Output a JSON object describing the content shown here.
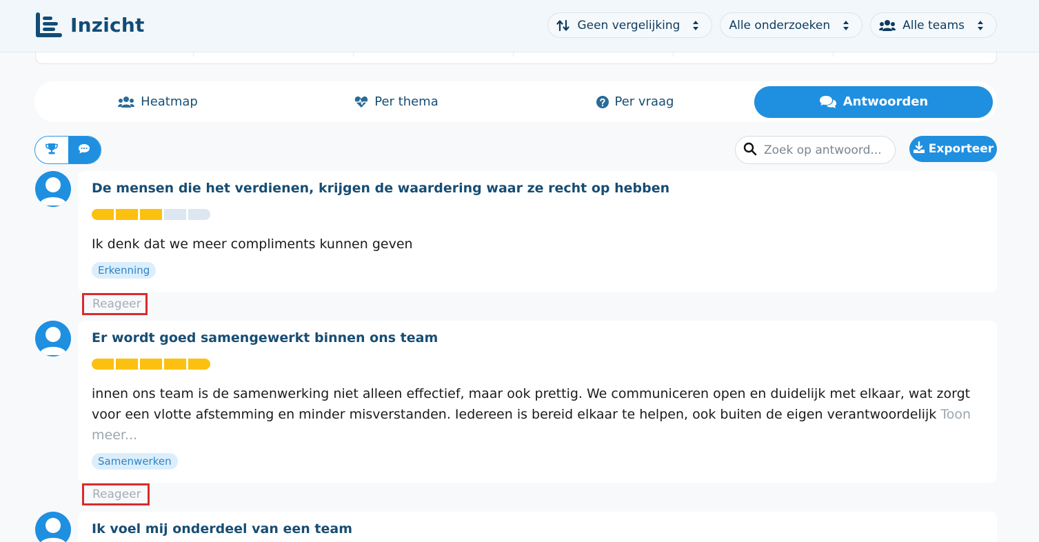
{
  "app": {
    "title": "Inzicht",
    "accent_color": "#1f8fe0",
    "brand_color": "#124c75"
  },
  "filters": [
    {
      "label": "Geen vergelijking",
      "icon": "sort-arrows-icon"
    },
    {
      "label": "Alle onderzoeken"
    },
    {
      "label": "Alle teams",
      "icon": "users-icon"
    }
  ],
  "tabs": [
    {
      "label": "Heatmap",
      "icon": "users-icon",
      "active": false
    },
    {
      "label": "Per thema",
      "icon": "heart-pulse-icon",
      "active": false
    },
    {
      "label": "Per vraag",
      "icon": "question-circle-icon",
      "active": false
    },
    {
      "label": "Antwoorden",
      "icon": "comments-icon",
      "active": true
    }
  ],
  "view_toggle": {
    "options": [
      "trophy-icon",
      "comment-icon"
    ],
    "selected": "comment-icon"
  },
  "search": {
    "placeholder": "Zoek op antwoord...",
    "value": ""
  },
  "export": {
    "label": "Exporteer"
  },
  "answers": [
    {
      "question": "De mensen die het verdienen, krijgen de waardering waar ze recht op hebben",
      "rating": 3,
      "rating_max": 5,
      "text": "Ik denk dat we meer compliments kunnen geven",
      "more_label": "",
      "tag": "Erkenning",
      "reply_label": "Reageer"
    },
    {
      "question": "Er wordt goed samengewerkt binnen ons team",
      "rating": 5,
      "rating_max": 5,
      "text": "innen ons team is de samenwerking niet alleen effectief, maar ook prettig. We communiceren open en duidelijk met elkaar, wat zorgt voor een vlotte afstemming en minder misverstanden. Iedereen is bereid elkaar te helpen, ook buiten de eigen verantwoordelijk",
      "more_label": "Toon meer...",
      "tag": "Samenwerken",
      "reply_label": "Reageer"
    },
    {
      "question": "Ik voel mij onderdeel van een team"
    }
  ]
}
